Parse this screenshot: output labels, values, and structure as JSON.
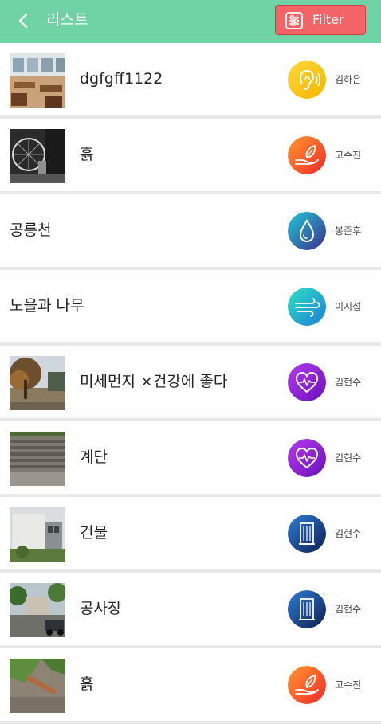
{
  "header": {
    "title": "리스트",
    "filter_label": "Filter",
    "back_icon": "chevron-left-icon",
    "filter_icon": "sliders-icon"
  },
  "colors": {
    "header_bg": "#6fd3a5",
    "filter_bg": "#f26466"
  },
  "items": [
    {
      "title": "dgfgff1122",
      "author": "김하은",
      "category_icon": "ear-icon",
      "thumb": "restaurant-photo"
    },
    {
      "title": "흙",
      "author": "고수진",
      "category_icon": "hand-leaf-icon",
      "thumb": "bicycle-photo"
    },
    {
      "title": "공릉천",
      "author": "봉준후",
      "category_icon": "water-drop-icon",
      "thumb": ""
    },
    {
      "title": "노을과 나무",
      "author": "이지섭",
      "category_icon": "wind-icon",
      "thumb": ""
    },
    {
      "title": "미세먼지 ×건강에 좋다",
      "author": "김현수",
      "category_icon": "heart-pulse-icon",
      "thumb": "park-tree-photo"
    },
    {
      "title": "계단",
      "author": "김현수",
      "category_icon": "heart-pulse-icon",
      "thumb": "stairs-photo"
    },
    {
      "title": "건물",
      "author": "김현수",
      "category_icon": "building-icon",
      "thumb": "building-photo"
    },
    {
      "title": "공사장",
      "author": "김현수",
      "category_icon": "building-icon",
      "thumb": "construction-photo"
    },
    {
      "title": "흙",
      "author": "고수진",
      "category_icon": "hand-leaf-icon",
      "thumb": "soil-photo"
    }
  ]
}
